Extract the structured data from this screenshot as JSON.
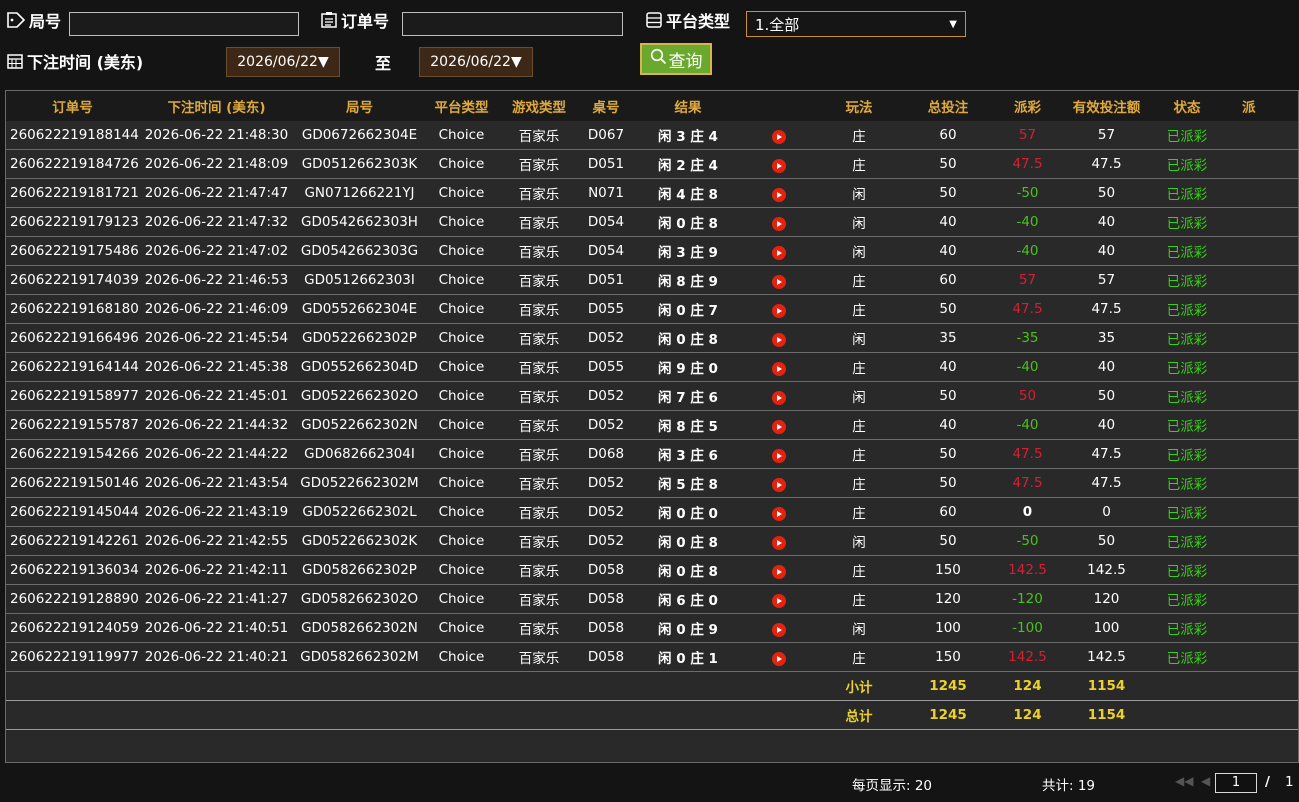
{
  "filters": {
    "round_label": "局号",
    "round_value": "",
    "order_label": "订单号",
    "order_value": "",
    "platform_label": "平台类型",
    "platform_value": "1.全部",
    "time_label": "下注时间 (美东)",
    "date_from": "2026/06/22▼",
    "to_label": "至",
    "date_to": "2026/06/22▼",
    "query_label": "查询"
  },
  "table": {
    "headers": [
      "订单号",
      "下注时间 (美东)",
      "局号",
      "平台类型",
      "游戏类型",
      "桌号",
      "结果",
      "",
      "玩法",
      "总投注",
      "派彩",
      "有效投注额",
      "状态",
      "派"
    ],
    "rows": [
      [
        "260622219188144",
        "2026-06-22 21:48:30",
        "GD0672662304E",
        "Choice",
        "百家乐",
        "D067",
        "闲 3 庄 4",
        "庄",
        "60",
        "57",
        "57",
        "已派彩"
      ],
      [
        "260622219184726",
        "2026-06-22 21:48:09",
        "GD0512662303K",
        "Choice",
        "百家乐",
        "D051",
        "闲 2 庄 4",
        "庄",
        "50",
        "47.5",
        "47.5",
        "已派彩"
      ],
      [
        "260622219181721",
        "2026-06-22 21:47:47",
        "GN071266221YJ",
        "Choice",
        "百家乐",
        "N071",
        "闲 4 庄 8",
        "闲",
        "50",
        "-50",
        "50",
        "已派彩"
      ],
      [
        "260622219179123",
        "2026-06-22 21:47:32",
        "GD0542662303H",
        "Choice",
        "百家乐",
        "D054",
        "闲 0 庄 8",
        "闲",
        "40",
        "-40",
        "40",
        "已派彩"
      ],
      [
        "260622219175486",
        "2026-06-22 21:47:02",
        "GD0542662303G",
        "Choice",
        "百家乐",
        "D054",
        "闲 3 庄 9",
        "闲",
        "40",
        "-40",
        "40",
        "已派彩"
      ],
      [
        "260622219174039",
        "2026-06-22 21:46:53",
        "GD0512662303I",
        "Choice",
        "百家乐",
        "D051",
        "闲 8 庄 9",
        "庄",
        "60",
        "57",
        "57",
        "已派彩"
      ],
      [
        "260622219168180",
        "2026-06-22 21:46:09",
        "GD0552662304E",
        "Choice",
        "百家乐",
        "D055",
        "闲 0 庄 7",
        "庄",
        "50",
        "47.5",
        "47.5",
        "已派彩"
      ],
      [
        "260622219166496",
        "2026-06-22 21:45:54",
        "GD0522662302P",
        "Choice",
        "百家乐",
        "D052",
        "闲 0 庄 8",
        "闲",
        "35",
        "-35",
        "35",
        "已派彩"
      ],
      [
        "260622219164144",
        "2026-06-22 21:45:38",
        "GD0552662304D",
        "Choice",
        "百家乐",
        "D055",
        "闲 9 庄 0",
        "庄",
        "40",
        "-40",
        "40",
        "已派彩"
      ],
      [
        "260622219158977",
        "2026-06-22 21:45:01",
        "GD0522662302O",
        "Choice",
        "百家乐",
        "D052",
        "闲 7 庄 6",
        "闲",
        "50",
        "50",
        "50",
        "已派彩"
      ],
      [
        "260622219155787",
        "2026-06-22 21:44:32",
        "GD0522662302N",
        "Choice",
        "百家乐",
        "D052",
        "闲 8 庄 5",
        "庄",
        "40",
        "-40",
        "40",
        "已派彩"
      ],
      [
        "260622219154266",
        "2026-06-22 21:44:22",
        "GD0682662304I",
        "Choice",
        "百家乐",
        "D068",
        "闲 3 庄 6",
        "庄",
        "50",
        "47.5",
        "47.5",
        "已派彩"
      ],
      [
        "260622219150146",
        "2026-06-22 21:43:54",
        "GD0522662302M",
        "Choice",
        "百家乐",
        "D052",
        "闲 5 庄 8",
        "庄",
        "50",
        "47.5",
        "47.5",
        "已派彩"
      ],
      [
        "260622219145044",
        "2026-06-22 21:43:19",
        "GD0522662302L",
        "Choice",
        "百家乐",
        "D052",
        "闲 0 庄 0",
        "庄",
        "60",
        "0",
        "0",
        "已派彩"
      ],
      [
        "260622219142261",
        "2026-06-22 21:42:55",
        "GD0522662302K",
        "Choice",
        "百家乐",
        "D052",
        "闲 0 庄 8",
        "闲",
        "50",
        "-50",
        "50",
        "已派彩"
      ],
      [
        "260622219136034",
        "2026-06-22 21:42:11",
        "GD0582662302P",
        "Choice",
        "百家乐",
        "D058",
        "闲 0 庄 8",
        "庄",
        "150",
        "142.5",
        "142.5",
        "已派彩"
      ],
      [
        "260622219128890",
        "2026-06-22 21:41:27",
        "GD0582662302O",
        "Choice",
        "百家乐",
        "D058",
        "闲 6 庄 0",
        "庄",
        "120",
        "-120",
        "120",
        "已派彩"
      ],
      [
        "260622219124059",
        "2026-06-22 21:40:51",
        "GD0582662302N",
        "Choice",
        "百家乐",
        "D058",
        "闲 0 庄 9",
        "闲",
        "100",
        "-100",
        "100",
        "已派彩"
      ],
      [
        "260622219119977",
        "2026-06-22 21:40:21",
        "GD0582662302M",
        "Choice",
        "百家乐",
        "D058",
        "闲 0 庄 1",
        "庄",
        "150",
        "142.5",
        "142.5",
        "已派彩"
      ]
    ],
    "subtotal": {
      "label": "小计",
      "total_bet": "1245",
      "payout": "124",
      "valid_bet": "1154"
    },
    "total": {
      "label": "总计",
      "total_bet": "1245",
      "payout": "124",
      "valid_bet": "1154"
    }
  },
  "footer": {
    "per_page": "每页显示: 20",
    "count": "共计: 19",
    "page_current": "1",
    "page_sep": "/",
    "page_total": "1"
  },
  "colors": {
    "header_gold": "#dfa93c",
    "loss_green": "#4ac21a",
    "win_red": "#d62032",
    "status_green": "#39d018",
    "sum_yellow": "#ecd12a",
    "query_green": "#6aa92e"
  }
}
